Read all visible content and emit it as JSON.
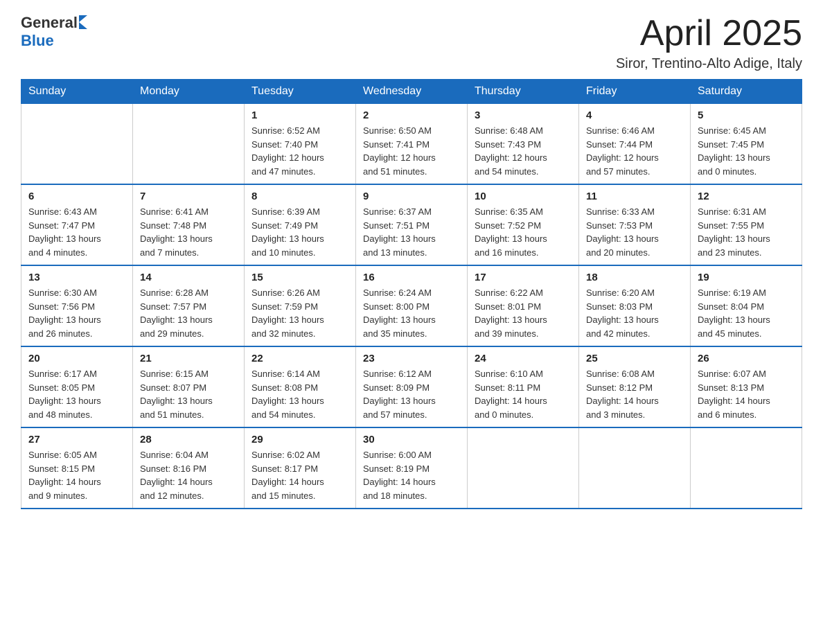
{
  "header": {
    "logo_general": "General",
    "logo_blue": "Blue",
    "month_title": "April 2025",
    "location": "Siror, Trentino-Alto Adige, Italy"
  },
  "days_of_week": [
    "Sunday",
    "Monday",
    "Tuesday",
    "Wednesday",
    "Thursday",
    "Friday",
    "Saturday"
  ],
  "weeks": [
    [
      {
        "day": "",
        "info": ""
      },
      {
        "day": "",
        "info": ""
      },
      {
        "day": "1",
        "info": "Sunrise: 6:52 AM\nSunset: 7:40 PM\nDaylight: 12 hours\nand 47 minutes."
      },
      {
        "day": "2",
        "info": "Sunrise: 6:50 AM\nSunset: 7:41 PM\nDaylight: 12 hours\nand 51 minutes."
      },
      {
        "day": "3",
        "info": "Sunrise: 6:48 AM\nSunset: 7:43 PM\nDaylight: 12 hours\nand 54 minutes."
      },
      {
        "day": "4",
        "info": "Sunrise: 6:46 AM\nSunset: 7:44 PM\nDaylight: 12 hours\nand 57 minutes."
      },
      {
        "day": "5",
        "info": "Sunrise: 6:45 AM\nSunset: 7:45 PM\nDaylight: 13 hours\nand 0 minutes."
      }
    ],
    [
      {
        "day": "6",
        "info": "Sunrise: 6:43 AM\nSunset: 7:47 PM\nDaylight: 13 hours\nand 4 minutes."
      },
      {
        "day": "7",
        "info": "Sunrise: 6:41 AM\nSunset: 7:48 PM\nDaylight: 13 hours\nand 7 minutes."
      },
      {
        "day": "8",
        "info": "Sunrise: 6:39 AM\nSunset: 7:49 PM\nDaylight: 13 hours\nand 10 minutes."
      },
      {
        "day": "9",
        "info": "Sunrise: 6:37 AM\nSunset: 7:51 PM\nDaylight: 13 hours\nand 13 minutes."
      },
      {
        "day": "10",
        "info": "Sunrise: 6:35 AM\nSunset: 7:52 PM\nDaylight: 13 hours\nand 16 minutes."
      },
      {
        "day": "11",
        "info": "Sunrise: 6:33 AM\nSunset: 7:53 PM\nDaylight: 13 hours\nand 20 minutes."
      },
      {
        "day": "12",
        "info": "Sunrise: 6:31 AM\nSunset: 7:55 PM\nDaylight: 13 hours\nand 23 minutes."
      }
    ],
    [
      {
        "day": "13",
        "info": "Sunrise: 6:30 AM\nSunset: 7:56 PM\nDaylight: 13 hours\nand 26 minutes."
      },
      {
        "day": "14",
        "info": "Sunrise: 6:28 AM\nSunset: 7:57 PM\nDaylight: 13 hours\nand 29 minutes."
      },
      {
        "day": "15",
        "info": "Sunrise: 6:26 AM\nSunset: 7:59 PM\nDaylight: 13 hours\nand 32 minutes."
      },
      {
        "day": "16",
        "info": "Sunrise: 6:24 AM\nSunset: 8:00 PM\nDaylight: 13 hours\nand 35 minutes."
      },
      {
        "day": "17",
        "info": "Sunrise: 6:22 AM\nSunset: 8:01 PM\nDaylight: 13 hours\nand 39 minutes."
      },
      {
        "day": "18",
        "info": "Sunrise: 6:20 AM\nSunset: 8:03 PM\nDaylight: 13 hours\nand 42 minutes."
      },
      {
        "day": "19",
        "info": "Sunrise: 6:19 AM\nSunset: 8:04 PM\nDaylight: 13 hours\nand 45 minutes."
      }
    ],
    [
      {
        "day": "20",
        "info": "Sunrise: 6:17 AM\nSunset: 8:05 PM\nDaylight: 13 hours\nand 48 minutes."
      },
      {
        "day": "21",
        "info": "Sunrise: 6:15 AM\nSunset: 8:07 PM\nDaylight: 13 hours\nand 51 minutes."
      },
      {
        "day": "22",
        "info": "Sunrise: 6:14 AM\nSunset: 8:08 PM\nDaylight: 13 hours\nand 54 minutes."
      },
      {
        "day": "23",
        "info": "Sunrise: 6:12 AM\nSunset: 8:09 PM\nDaylight: 13 hours\nand 57 minutes."
      },
      {
        "day": "24",
        "info": "Sunrise: 6:10 AM\nSunset: 8:11 PM\nDaylight: 14 hours\nand 0 minutes."
      },
      {
        "day": "25",
        "info": "Sunrise: 6:08 AM\nSunset: 8:12 PM\nDaylight: 14 hours\nand 3 minutes."
      },
      {
        "day": "26",
        "info": "Sunrise: 6:07 AM\nSunset: 8:13 PM\nDaylight: 14 hours\nand 6 minutes."
      }
    ],
    [
      {
        "day": "27",
        "info": "Sunrise: 6:05 AM\nSunset: 8:15 PM\nDaylight: 14 hours\nand 9 minutes."
      },
      {
        "day": "28",
        "info": "Sunrise: 6:04 AM\nSunset: 8:16 PM\nDaylight: 14 hours\nand 12 minutes."
      },
      {
        "day": "29",
        "info": "Sunrise: 6:02 AM\nSunset: 8:17 PM\nDaylight: 14 hours\nand 15 minutes."
      },
      {
        "day": "30",
        "info": "Sunrise: 6:00 AM\nSunset: 8:19 PM\nDaylight: 14 hours\nand 18 minutes."
      },
      {
        "day": "",
        "info": ""
      },
      {
        "day": "",
        "info": ""
      },
      {
        "day": "",
        "info": ""
      }
    ]
  ]
}
